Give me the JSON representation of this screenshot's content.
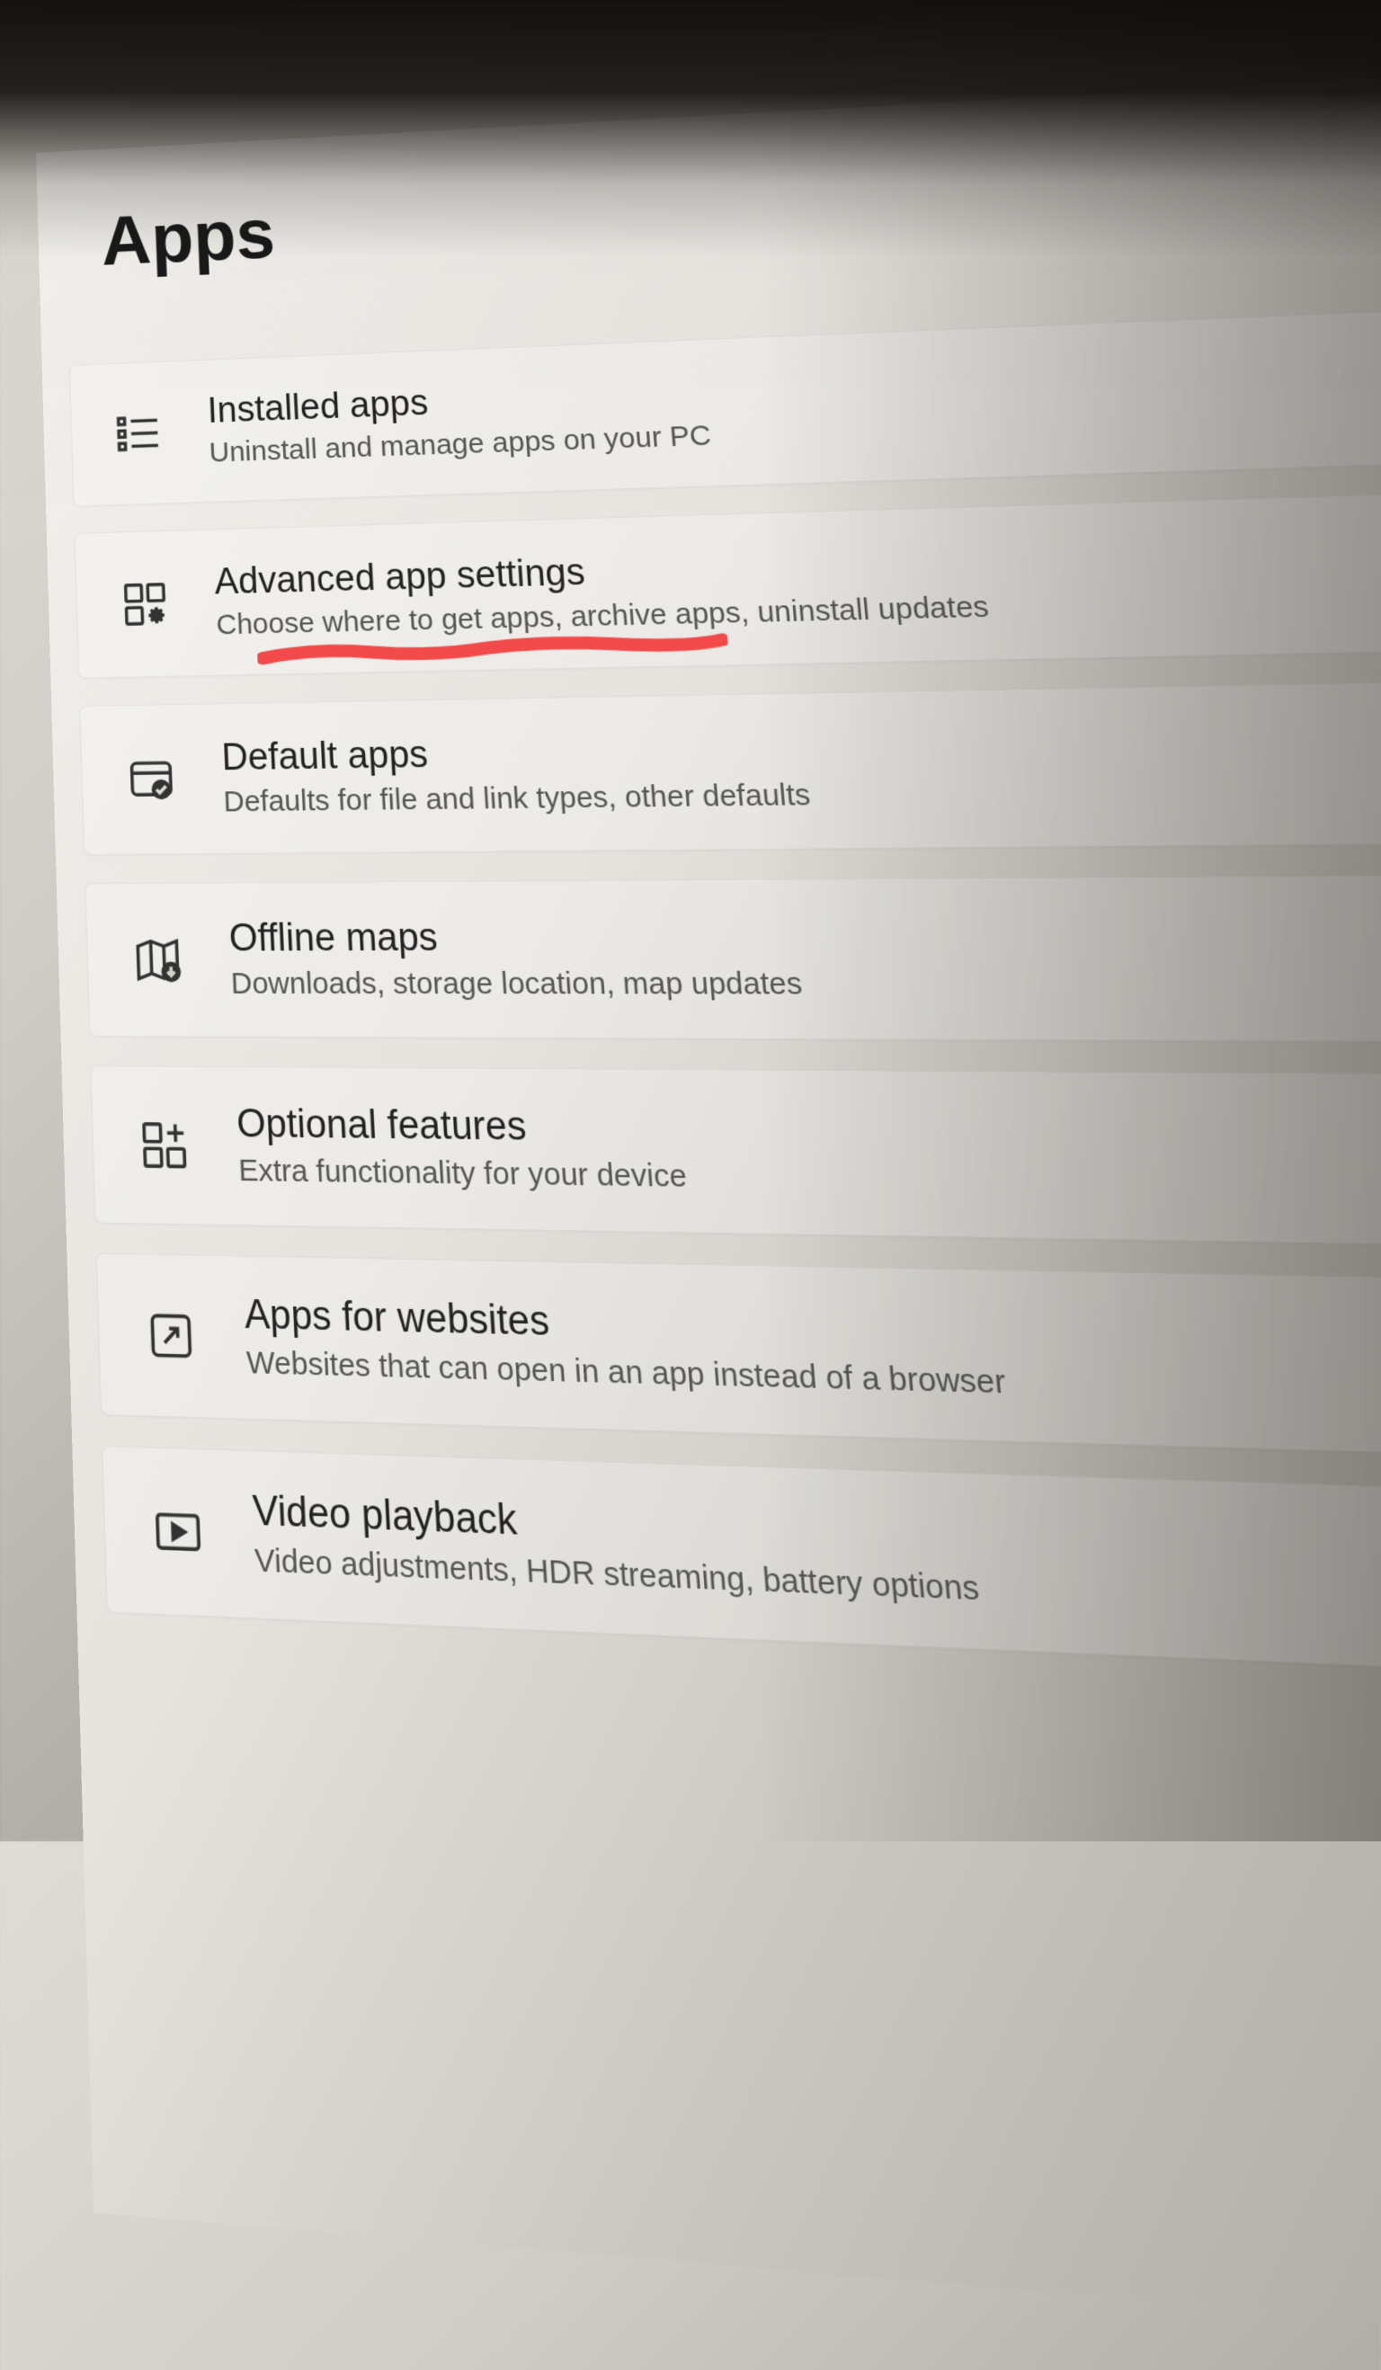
{
  "page": {
    "title": "Apps"
  },
  "items": [
    {
      "title": "Installed apps",
      "subtitle": "Uninstall and manage apps on your PC",
      "icon": "installed-apps-icon"
    },
    {
      "title": "Advanced app settings",
      "subtitle": "Choose where to get apps, archive apps, uninstall updates",
      "icon": "advanced-settings-icon",
      "annotated": true
    },
    {
      "title": "Default apps",
      "subtitle": "Defaults for file and link types, other defaults",
      "icon": "default-apps-icon"
    },
    {
      "title": "Offline maps",
      "subtitle": "Downloads, storage location, map updates",
      "icon": "offline-maps-icon"
    },
    {
      "title": "Optional features",
      "subtitle": "Extra functionality for your device",
      "icon": "optional-features-icon"
    },
    {
      "title": "Apps for websites",
      "subtitle": "Websites that can open in an app instead of a browser",
      "icon": "apps-for-websites-icon"
    },
    {
      "title": "Video playback",
      "subtitle": "Video adjustments, HDR streaming, battery options",
      "icon": "video-playback-icon"
    }
  ],
  "annotation_color": "#f24a4a"
}
